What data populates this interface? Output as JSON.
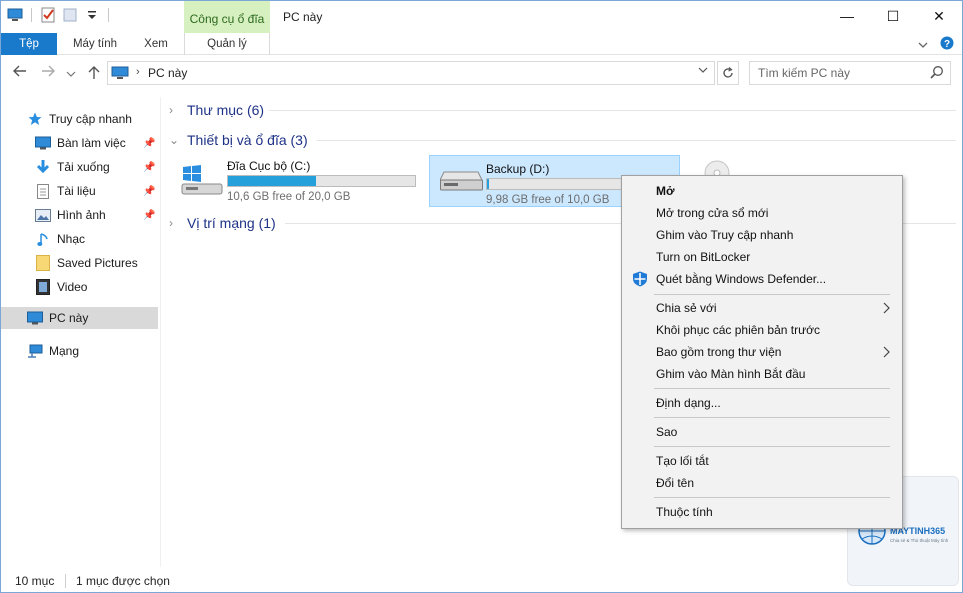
{
  "window": {
    "title": "PC này",
    "contextual_tab_label": "Công cụ ổ đĩa",
    "controls": {
      "minimize": "—",
      "maximize": "☐",
      "close": "✕"
    }
  },
  "ribbon": {
    "tabs": [
      {
        "label": "Tệp"
      },
      {
        "label": "Máy tính"
      },
      {
        "label": "Xem"
      },
      {
        "label": "Quản lý"
      }
    ]
  },
  "address": {
    "crumb": "PC này",
    "search_placeholder": "Tìm kiếm PC này"
  },
  "nav": {
    "quick_access": "Truy cập nhanh",
    "items": [
      {
        "label": "Bàn làm việc",
        "icon": "desktop-icon",
        "pinned": true
      },
      {
        "label": "Tải xuống",
        "icon": "download-icon",
        "pinned": true
      },
      {
        "label": "Tài liệu",
        "icon": "document-icon",
        "pinned": true
      },
      {
        "label": "Hình ảnh",
        "icon": "pictures-icon",
        "pinned": true
      },
      {
        "label": "Nhạc",
        "icon": "music-icon",
        "pinned": false
      },
      {
        "label": "Saved Pictures",
        "icon": "folder-icon",
        "pinned": false
      },
      {
        "label": "Video",
        "icon": "video-icon",
        "pinned": false
      }
    ],
    "this_pc": "PC này",
    "network": "Mạng"
  },
  "content": {
    "groups": [
      {
        "label": "Thư mục (6)",
        "expanded": false
      },
      {
        "label": "Thiết bị và ổ đĩa (3)",
        "expanded": true
      },
      {
        "label": "Vị trí mạng (1)",
        "expanded": false
      }
    ],
    "drives": [
      {
        "name": "Đĩa Cục bộ (C:)",
        "free_text": "10,6 GB free of 20,0 GB",
        "used_fraction": 0.47,
        "selected": false
      },
      {
        "name": "Backup (D:)",
        "free_text": "9,98 GB free of 10,0 GB",
        "used_fraction": 0.01,
        "selected": true
      }
    ]
  },
  "status": {
    "item_count": "10 mục",
    "selected": "1 mục được chọn"
  },
  "context_menu": {
    "items": [
      {
        "label": "Mở",
        "bold": true
      },
      {
        "label": "Mở trong cửa sổ mới"
      },
      {
        "label": "Ghim vào Truy cập nhanh"
      },
      {
        "label": "Turn on BitLocker"
      },
      {
        "label": "Quét bằng Windows Defender...",
        "icon": "windows-defender-icon"
      },
      {
        "label": "Chia sẻ với",
        "submenu": true
      },
      {
        "label": "Khôi phục các phiên bản trước"
      },
      {
        "label": "Bao gồm trong thư viện",
        "submenu": true
      },
      {
        "label": "Ghim vào Màn hình Bắt đầu"
      },
      {
        "label": "Định dạng..."
      },
      {
        "label": "Sao"
      },
      {
        "label": "Tạo lối tắt"
      },
      {
        "label": "Đổi tên"
      },
      {
        "label": "Thuộc tính"
      }
    ]
  },
  "watermark": {
    "brand": "MAYTINH365",
    "tagline": "Chia sẻ & Thủ thuật Máy tính"
  },
  "colors": {
    "accent": "#1979ca",
    "group_header": "#1e3287",
    "usage_bar": "#26a0da",
    "selection": "#cce8ff"
  }
}
